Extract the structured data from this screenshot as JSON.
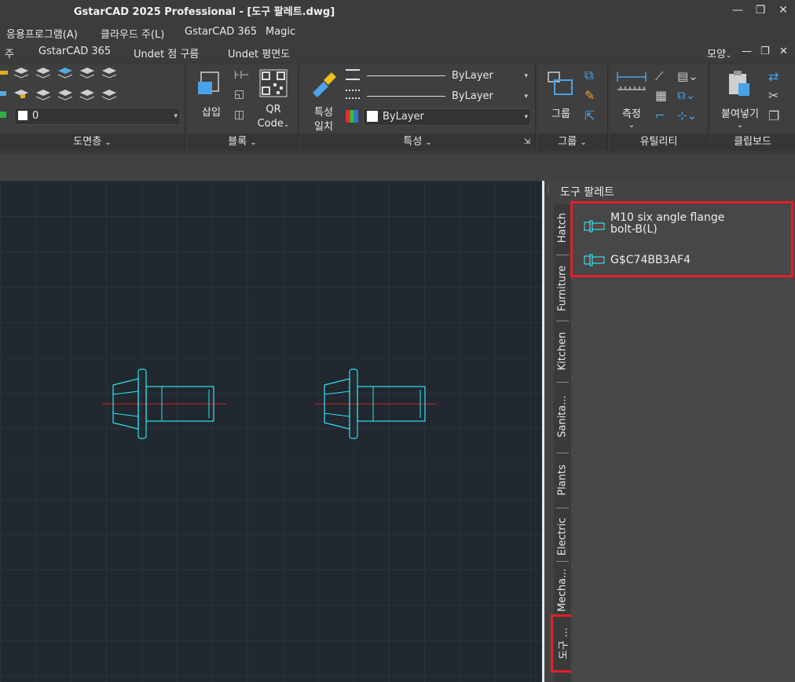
{
  "window": {
    "title": "GstarCAD 2025 Professional - [도구 팔레트.dwg]",
    "minimize": "—",
    "restore": "❐",
    "close": "✕"
  },
  "menu": {
    "items": [
      "응용프로그램(A)",
      "클라우드 주(L)",
      "GstarCAD 365",
      "Magic"
    ]
  },
  "tabs": {
    "items": [
      "주",
      "GstarCAD 365",
      "Undet 점 구름",
      "Undet 평면도"
    ],
    "right_label": "모양",
    "min": "—",
    "restore": "❐",
    "close": "✕"
  },
  "ribbon": {
    "layer": {
      "combo_value": "0",
      "label": "도면층"
    },
    "block": {
      "insert_label": "삽입",
      "qr_label_1": "QR",
      "qr_label_2": "Code",
      "label": "블록"
    },
    "properties": {
      "match_label_1": "특성",
      "match_label_2": "일치",
      "color_combo": "ByLayer",
      "linetype_combo": "ByLayer",
      "lineweight_combo": "ByLayer",
      "label": "특성"
    },
    "group": {
      "group_label": "그룹",
      "label": "그룹"
    },
    "utility": {
      "measure_label": "측정",
      "label": "유틸리티"
    },
    "clipboard": {
      "paste_label": "붙여넣기",
      "label": "클립보드"
    }
  },
  "palette": {
    "title": "도구 팔레트",
    "tabs": [
      "Hatch",
      "Furniture",
      "Kitchen",
      "Sanita...",
      "Plants",
      "Electric",
      "Mecha...",
      "도구 ..."
    ],
    "items": [
      {
        "label_line1": "M10 six angle flange",
        "label_line2": "bolt-B(L)",
        "icon": "bolt-block-icon"
      },
      {
        "label_line1": "G$C74BB3AF4",
        "label_line2": "",
        "icon": "bolt-block-icon"
      }
    ]
  },
  "colors": {
    "canvas_bg": "#212830",
    "bolt_stroke": "#2fe3f0",
    "centerline": "#d42020",
    "highlight": "#e0202a"
  }
}
